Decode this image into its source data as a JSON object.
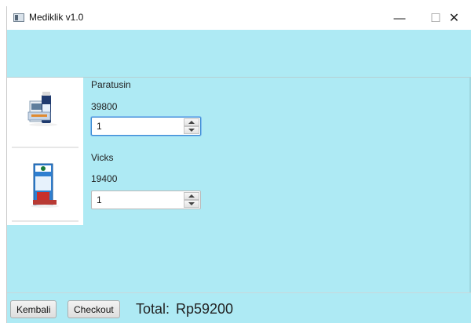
{
  "window": {
    "title": "Mediklik v1.0",
    "controls": {
      "minimize": "—",
      "maximize": "☐",
      "close": "✕"
    }
  },
  "products": [
    {
      "name": "Paratusin",
      "price": "39800",
      "quantity": "1",
      "image_icon": "paratusin-box-icon"
    },
    {
      "name": "Vicks",
      "price": "19400",
      "quantity": "1",
      "image_icon": "vicks-box-icon"
    }
  ],
  "footer": {
    "back_label": "Kembali",
    "checkout_label": "Checkout",
    "total_label": "Total:",
    "total_value": "Rp59200"
  },
  "colors": {
    "content_background": "#aeeaf4",
    "spinner_focus": "#3a8bd3"
  }
}
